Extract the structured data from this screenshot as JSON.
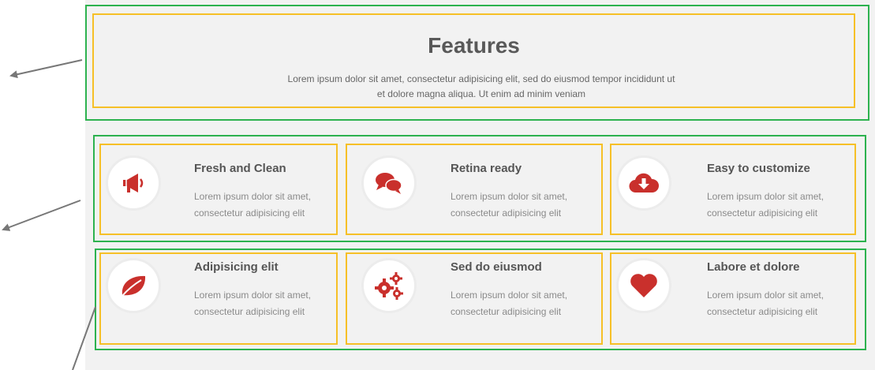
{
  "features": {
    "title": "Features",
    "description_line1": "Lorem ipsum dolor sit amet, consectetur adipisicing elit, sed do eiusmod tempor incididunt ut",
    "description_line2": "et dolore magna aliqua. Ut enim ad minim veniam"
  },
  "cards": [
    {
      "title": "Fresh and Clean",
      "line1": "Lorem ipsum dolor sit amet,",
      "line2": "consectetur adipisicing elit",
      "icon": "megaphone-icon"
    },
    {
      "title": "Retina ready",
      "line1": "Lorem ipsum dolor sit amet,",
      "line2": "consectetur adipisicing elit",
      "icon": "chat-bubbles-icon"
    },
    {
      "title": "Easy to customize",
      "line1": "Lorem ipsum dolor sit amet,",
      "line2": "consectetur adipisicing elit",
      "icon": "cloud-download-icon"
    },
    {
      "title": "Adipisicing elit",
      "line1": "Lorem ipsum dolor sit amet,",
      "line2": "consectetur adipisicing elit",
      "icon": "leaf-icon"
    },
    {
      "title": "Sed do eiusmod",
      "line1": "Lorem ipsum dolor sit amet,",
      "line2": "consectetur adipisicing elit",
      "icon": "gears-icon"
    },
    {
      "title": "Labore et dolore",
      "line1": "Lorem ipsum dolor sit amet,",
      "line2": "consectetur adipisicing elit",
      "icon": "heart-icon"
    }
  ],
  "colors": {
    "outer_box": "#2db24f",
    "inner_box": "#f6c027",
    "icon_red": "#c9302c",
    "arrow": "#777777",
    "panel_bg": "#f2f2f2"
  }
}
